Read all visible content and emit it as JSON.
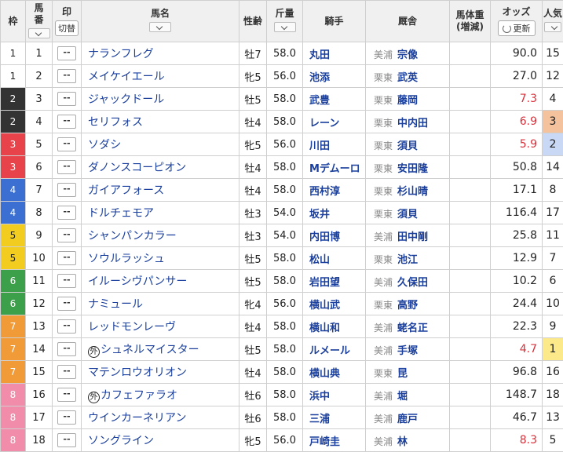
{
  "headers": {
    "waku": "枠",
    "umaban_1": "馬",
    "umaban_2": "番",
    "mark": "印",
    "mark_toggle": "切替",
    "horse": "馬名",
    "sexage": "性齢",
    "weight": "斤量",
    "jockey": "騎手",
    "stable": "厩舎",
    "bw_1": "馬体重",
    "bw_2": "(増減)",
    "odds": "オッズ",
    "refresh": "更新",
    "pop_1": "人気",
    "sort_icon": "chevron-down-icon"
  },
  "mark_placeholder": "--",
  "gaichi_mark": "外",
  "frame_colors": {
    "1": {
      "bg": "#ffffff",
      "fg": "#222222"
    },
    "2": {
      "bg": "#333333",
      "fg": "#ffffff"
    },
    "3": {
      "bg": "#e8424a",
      "fg": "#ffffff"
    },
    "4": {
      "bg": "#3b6fd2",
      "fg": "#ffffff"
    },
    "5": {
      "bg": "#f2cc1e",
      "fg": "#222222"
    },
    "6": {
      "bg": "#3ca04a",
      "fg": "#ffffff"
    },
    "7": {
      "bg": "#f09a38",
      "fg": "#ffffff"
    },
    "8": {
      "bg": "#f28cab",
      "fg": "#ffffff"
    }
  },
  "popularity_highlight": {
    "1": "#fbe98a",
    "2": "#c9d8f5",
    "3": "#f4c29c"
  },
  "rows": [
    {
      "waku": "1",
      "umaban": "1",
      "horse": "ナランフレグ",
      "gaichi": false,
      "sexage": "牡7",
      "weight": "58.0",
      "jockey": "丸田",
      "region": "美浦",
      "trainer": "宗像",
      "bodyweight": "",
      "odds": "90.0",
      "odds_red": false,
      "pop": "15"
    },
    {
      "waku": "1",
      "umaban": "2",
      "horse": "メイケイエール",
      "gaichi": false,
      "sexage": "牝5",
      "weight": "56.0",
      "jockey": "池添",
      "region": "栗東",
      "trainer": "武英",
      "bodyweight": "",
      "odds": "27.0",
      "odds_red": false,
      "pop": "12"
    },
    {
      "waku": "2",
      "umaban": "3",
      "horse": "ジャックドール",
      "gaichi": false,
      "sexage": "牡5",
      "weight": "58.0",
      "jockey": "武豊",
      "region": "栗東",
      "trainer": "藤岡",
      "bodyweight": "",
      "odds": "7.3",
      "odds_red": true,
      "pop": "4"
    },
    {
      "waku": "2",
      "umaban": "4",
      "horse": "セリフォス",
      "gaichi": false,
      "sexage": "牡4",
      "weight": "58.0",
      "jockey": "レーン",
      "region": "栗東",
      "trainer": "中内田",
      "bodyweight": "",
      "odds": "6.9",
      "odds_red": true,
      "pop": "3"
    },
    {
      "waku": "3",
      "umaban": "5",
      "horse": "ソダシ",
      "gaichi": false,
      "sexage": "牝5",
      "weight": "56.0",
      "jockey": "川田",
      "region": "栗東",
      "trainer": "須貝",
      "bodyweight": "",
      "odds": "5.9",
      "odds_red": true,
      "pop": "2"
    },
    {
      "waku": "3",
      "umaban": "6",
      "horse": "ダノンスコーピオン",
      "gaichi": false,
      "sexage": "牡4",
      "weight": "58.0",
      "jockey": "Mデムーロ",
      "region": "栗東",
      "trainer": "安田隆",
      "bodyweight": "",
      "odds": "50.8",
      "odds_red": false,
      "pop": "14"
    },
    {
      "waku": "4",
      "umaban": "7",
      "horse": "ガイアフォース",
      "gaichi": false,
      "sexage": "牡4",
      "weight": "58.0",
      "jockey": "西村淳",
      "region": "栗東",
      "trainer": "杉山晴",
      "bodyweight": "",
      "odds": "17.1",
      "odds_red": false,
      "pop": "8"
    },
    {
      "waku": "4",
      "umaban": "8",
      "horse": "ドルチェモア",
      "gaichi": false,
      "sexage": "牡3",
      "weight": "54.0",
      "jockey": "坂井",
      "region": "栗東",
      "trainer": "須貝",
      "bodyweight": "",
      "odds": "116.4",
      "odds_red": false,
      "pop": "17"
    },
    {
      "waku": "5",
      "umaban": "9",
      "horse": "シャンパンカラー",
      "gaichi": false,
      "sexage": "牡3",
      "weight": "54.0",
      "jockey": "内田博",
      "region": "美浦",
      "trainer": "田中剛",
      "bodyweight": "",
      "odds": "25.8",
      "odds_red": false,
      "pop": "11"
    },
    {
      "waku": "5",
      "umaban": "10",
      "horse": "ソウルラッシュ",
      "gaichi": false,
      "sexage": "牡5",
      "weight": "58.0",
      "jockey": "松山",
      "region": "栗東",
      "trainer": "池江",
      "bodyweight": "",
      "odds": "12.9",
      "odds_red": false,
      "pop": "7"
    },
    {
      "waku": "6",
      "umaban": "11",
      "horse": "イルーシヴパンサー",
      "gaichi": false,
      "sexage": "牡5",
      "weight": "58.0",
      "jockey": "岩田望",
      "region": "美浦",
      "trainer": "久保田",
      "bodyweight": "",
      "odds": "10.2",
      "odds_red": false,
      "pop": "6"
    },
    {
      "waku": "6",
      "umaban": "12",
      "horse": "ナミュール",
      "gaichi": false,
      "sexage": "牝4",
      "weight": "56.0",
      "jockey": "横山武",
      "region": "栗東",
      "trainer": "高野",
      "bodyweight": "",
      "odds": "24.4",
      "odds_red": false,
      "pop": "10"
    },
    {
      "waku": "7",
      "umaban": "13",
      "horse": "レッドモンレーヴ",
      "gaichi": false,
      "sexage": "牡4",
      "weight": "58.0",
      "jockey": "横山和",
      "region": "美浦",
      "trainer": "蛯名正",
      "bodyweight": "",
      "odds": "22.3",
      "odds_red": false,
      "pop": "9"
    },
    {
      "waku": "7",
      "umaban": "14",
      "horse": "シュネルマイスター",
      "gaichi": true,
      "sexage": "牡5",
      "weight": "58.0",
      "jockey": "ルメール",
      "region": "美浦",
      "trainer": "手塚",
      "bodyweight": "",
      "odds": "4.7",
      "odds_red": true,
      "pop": "1"
    },
    {
      "waku": "7",
      "umaban": "15",
      "horse": "マテンロウオリオン",
      "gaichi": false,
      "sexage": "牡4",
      "weight": "58.0",
      "jockey": "横山典",
      "region": "栗東",
      "trainer": "昆",
      "bodyweight": "",
      "odds": "96.8",
      "odds_red": false,
      "pop": "16"
    },
    {
      "waku": "8",
      "umaban": "16",
      "horse": "カフェファラオ",
      "gaichi": true,
      "sexage": "牡6",
      "weight": "58.0",
      "jockey": "浜中",
      "region": "美浦",
      "trainer": "堀",
      "bodyweight": "",
      "odds": "148.7",
      "odds_red": false,
      "pop": "18"
    },
    {
      "waku": "8",
      "umaban": "17",
      "horse": "ウインカーネリアン",
      "gaichi": false,
      "sexage": "牡6",
      "weight": "58.0",
      "jockey": "三浦",
      "region": "美浦",
      "trainer": "鹿戸",
      "bodyweight": "",
      "odds": "46.7",
      "odds_red": false,
      "pop": "13"
    },
    {
      "waku": "8",
      "umaban": "18",
      "horse": "ソングライン",
      "gaichi": false,
      "sexage": "牝5",
      "weight": "56.0",
      "jockey": "戸崎圭",
      "region": "美浦",
      "trainer": "林",
      "bodyweight": "",
      "odds": "8.3",
      "odds_red": true,
      "pop": "5"
    }
  ]
}
